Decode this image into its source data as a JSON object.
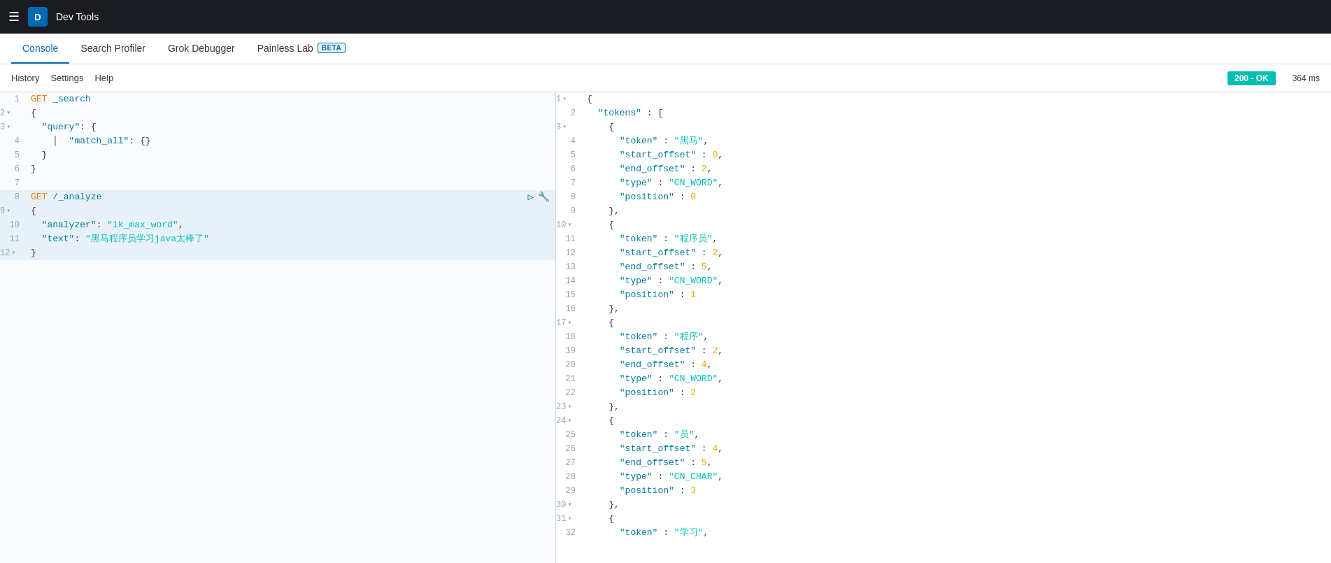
{
  "topbar": {
    "hamburger": "☰",
    "avatar_letter": "D",
    "app_name": "Dev Tools"
  },
  "nav": {
    "tabs": [
      {
        "id": "console",
        "label": "Console",
        "active": true,
        "beta": false
      },
      {
        "id": "search-profiler",
        "label": "Search Profiler",
        "active": false,
        "beta": false
      },
      {
        "id": "grok-debugger",
        "label": "Grok Debugger",
        "active": false,
        "beta": false
      },
      {
        "id": "painless-lab",
        "label": "Painless Lab",
        "active": false,
        "beta": true
      }
    ],
    "beta_label": "BETA"
  },
  "toolbar": {
    "history_label": "History",
    "settings_label": "Settings",
    "help_label": "Help",
    "status_code": "200 - OK",
    "response_time": "364 ms"
  },
  "editor": {
    "lines": [
      {
        "num": "1",
        "content": "GET _search",
        "type": "method_path",
        "highlight": false,
        "foldable": false
      },
      {
        "num": "2",
        "content": "{",
        "type": "code",
        "highlight": false,
        "foldable": true
      },
      {
        "num": "3",
        "content": "  \"query\": {",
        "type": "code",
        "highlight": false,
        "foldable": true
      },
      {
        "num": "4",
        "content": "    \"match_all\": {}",
        "type": "code",
        "highlight": false,
        "foldable": false
      },
      {
        "num": "5",
        "content": "  }",
        "type": "code",
        "highlight": false,
        "foldable": false
      },
      {
        "num": "6",
        "content": "}",
        "type": "code",
        "highlight": false,
        "foldable": false
      },
      {
        "num": "7",
        "content": "",
        "type": "code",
        "highlight": false,
        "foldable": false
      },
      {
        "num": "8",
        "content": "GET /_analyze",
        "type": "method_path",
        "highlight": true,
        "foldable": false,
        "has_actions": true
      },
      {
        "num": "9",
        "content": "{",
        "type": "code",
        "highlight": true,
        "foldable": true
      },
      {
        "num": "10",
        "content": "  \"analyzer\": \"ik_max_word\",",
        "type": "code",
        "highlight": true,
        "foldable": false
      },
      {
        "num": "11",
        "content": "  \"text\": \"黑马程序员学习java太棒了\"",
        "type": "code",
        "highlight": true,
        "foldable": false
      },
      {
        "num": "12",
        "content": "}",
        "type": "code",
        "highlight": true,
        "foldable": true
      }
    ]
  },
  "response": {
    "lines": [
      {
        "num": "1",
        "foldable": true,
        "html": "{"
      },
      {
        "num": "2",
        "foldable": false,
        "html": "  \"tokens\" : ["
      },
      {
        "num": "3",
        "foldable": true,
        "html": "    {"
      },
      {
        "num": "4",
        "foldable": false,
        "html": "      \"token\" : \"黑马\","
      },
      {
        "num": "5",
        "foldable": false,
        "html": "      \"start_offset\" : 0,"
      },
      {
        "num": "6",
        "foldable": false,
        "html": "      \"end_offset\" : 2,"
      },
      {
        "num": "7",
        "foldable": false,
        "html": "      \"type\" : \"CN_WORD\","
      },
      {
        "num": "8",
        "foldable": false,
        "html": "      \"position\" : 0"
      },
      {
        "num": "9",
        "foldable": false,
        "html": "    },"
      },
      {
        "num": "10",
        "foldable": true,
        "html": "    {"
      },
      {
        "num": "11",
        "foldable": false,
        "html": "      \"token\" : \"程序员\","
      },
      {
        "num": "12",
        "foldable": false,
        "html": "      \"start_offset\" : 2,"
      },
      {
        "num": "13",
        "foldable": false,
        "html": "      \"end_offset\" : 5,"
      },
      {
        "num": "14",
        "foldable": false,
        "html": "      \"type\" : \"CN_WORD\","
      },
      {
        "num": "15",
        "foldable": false,
        "html": "      \"position\" : 1"
      },
      {
        "num": "16",
        "foldable": false,
        "html": "    },"
      },
      {
        "num": "17",
        "foldable": true,
        "html": "    {"
      },
      {
        "num": "18",
        "foldable": false,
        "html": "      \"token\" : \"程序\","
      },
      {
        "num": "19",
        "foldable": false,
        "html": "      \"start_offset\" : 2,"
      },
      {
        "num": "20",
        "foldable": false,
        "html": "      \"end_offset\" : 4,"
      },
      {
        "num": "21",
        "foldable": false,
        "html": "      \"type\" : \"CN_WORD\","
      },
      {
        "num": "22",
        "foldable": false,
        "html": "      \"position\" : 2"
      },
      {
        "num": "23",
        "foldable": false,
        "html": "    },"
      },
      {
        "num": "24",
        "foldable": true,
        "html": "    {"
      },
      {
        "num": "25",
        "foldable": false,
        "html": "      \"token\" : \"员\","
      },
      {
        "num": "26",
        "foldable": false,
        "html": "      \"start_offset\" : 4,"
      },
      {
        "num": "27",
        "foldable": false,
        "html": "      \"end_offset\" : 5,"
      },
      {
        "num": "28",
        "foldable": false,
        "html": "      \"type\" : \"CN_CHAR\","
      },
      {
        "num": "29",
        "foldable": false,
        "html": "      \"position\" : 3"
      },
      {
        "num": "30",
        "foldable": false,
        "html": "    },"
      },
      {
        "num": "31",
        "foldable": true,
        "html": "    {"
      },
      {
        "num": "32",
        "foldable": false,
        "html": "      \"token\" : \"学习\","
      }
    ]
  }
}
